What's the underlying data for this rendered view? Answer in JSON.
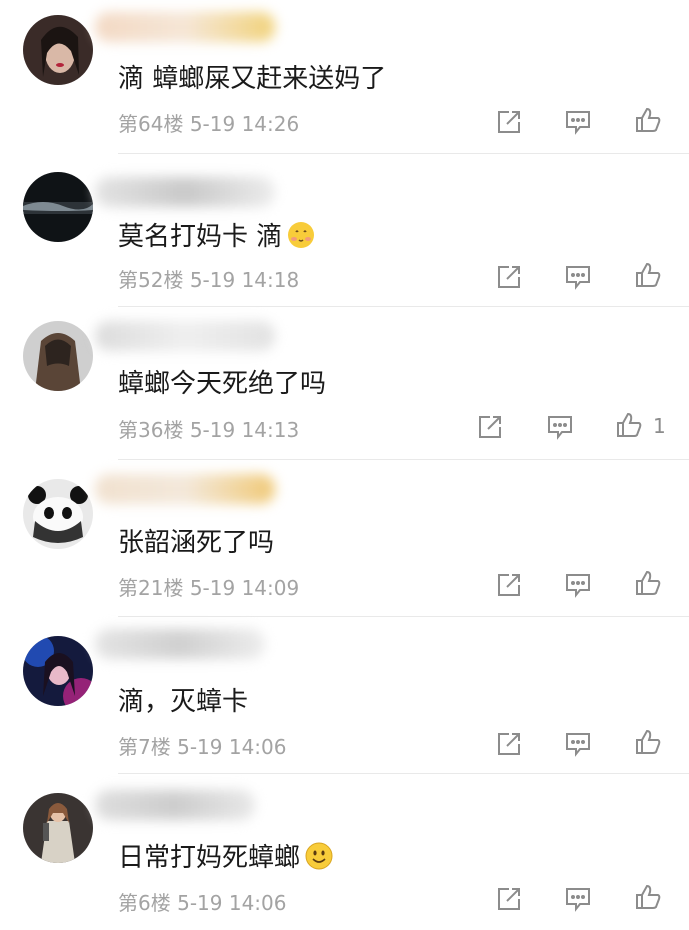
{
  "comments": [
    {
      "text": "滴 蟑螂屎又赶来送妈了",
      "floor": "第64楼",
      "date": "5-19",
      "time": "14:26",
      "likes": "",
      "emoji": "",
      "avatar": "avatar-woman-red-lips"
    },
    {
      "text": "莫名打妈卡 滴",
      "floor": "第52楼",
      "date": "5-19",
      "time": "14:18",
      "likes": "",
      "emoji": "blushing-face-emoji",
      "avatar": "avatar-dark-landscape"
    },
    {
      "text": "蟑螂今天死绝了吗",
      "floor": "第36楼",
      "date": "5-19",
      "time": "14:13",
      "likes": "1",
      "emoji": "",
      "avatar": "avatar-long-hair-back"
    },
    {
      "text": "张韶涵死了吗",
      "floor": "第21楼",
      "date": "5-19",
      "time": "14:09",
      "likes": "",
      "emoji": "",
      "avatar": "avatar-panda"
    },
    {
      "text": "滴，灭蟑卡",
      "floor": "第7楼",
      "date": "5-19",
      "time": "14:06",
      "likes": "",
      "emoji": "",
      "avatar": "avatar-neon-portrait"
    },
    {
      "text": "日常打妈死蟑螂",
      "floor": "第6楼",
      "date": "5-19",
      "time": "14:06",
      "likes": "",
      "emoji": "smiling-face-emoji",
      "avatar": "avatar-singer-stage"
    }
  ],
  "colors": {
    "text": "#1a1a1a",
    "meta": "#a3a3a3",
    "icon": "#8c8c8c"
  }
}
